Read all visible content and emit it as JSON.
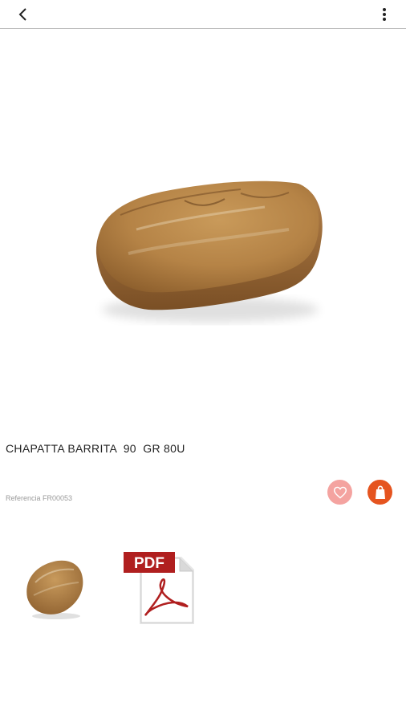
{
  "header": {
    "back_icon": "chevron-left-icon",
    "menu_icon": "more-vert-icon"
  },
  "product": {
    "title": "CHAPATTA BARRITA  90  GR 80U",
    "reference": "Referencia FR00053",
    "image": "chapatta-bread-image"
  },
  "actions": {
    "favorite_icon": "heart-icon",
    "favorite_color": "#f4a3a0",
    "cart_icon": "shopping-bag-icon",
    "cart_color": "#e5541f"
  },
  "attachments": {
    "thumbnail": "chapatta-bread-thumbnail",
    "pdf_label": "PDF"
  }
}
